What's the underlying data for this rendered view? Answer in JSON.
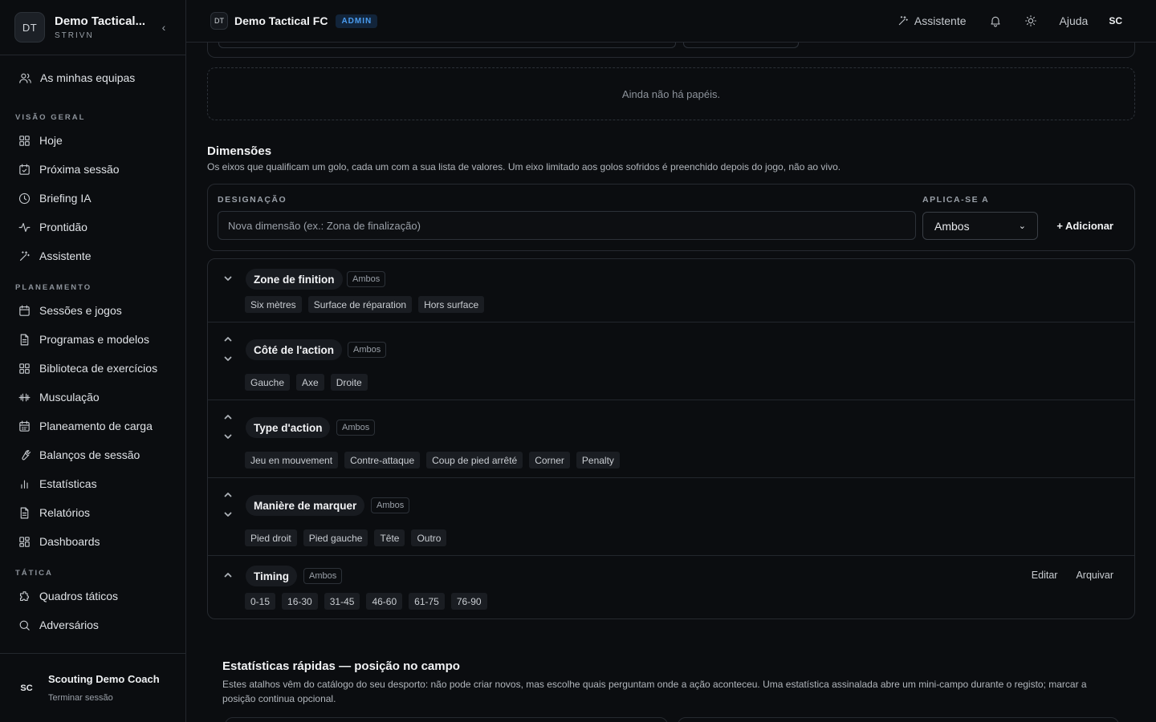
{
  "sidebar": {
    "team_initials": "DT",
    "team_name": "Demo Tactical...",
    "team_sub": "STRIVN",
    "my_teams": "As minhas equipas",
    "sections": [
      {
        "title": "VISÃO GERAL",
        "items": [
          "Hoje",
          "Próxima sessão",
          "Briefing IA",
          "Prontidão",
          "Assistente"
        ]
      },
      {
        "title": "PLANEAMENTO",
        "items": [
          "Sessões e jogos",
          "Programas e modelos",
          "Biblioteca de exercícios",
          "Musculação",
          "Planeamento de carga",
          "Balanços de sessão",
          "Estatísticas",
          "Relatórios",
          "Dashboards"
        ]
      },
      {
        "title": "TÁTICA",
        "items": [
          "Quadros táticos",
          "Adversários"
        ]
      }
    ],
    "user_initials": "SC",
    "user_name": "Scouting Demo Coach",
    "logout": "Terminar sessão"
  },
  "topbar": {
    "team_initials": "DT",
    "team_name": "Demo Tactical FC",
    "badge": "ADMIN",
    "assistant": "Assistente",
    "help": "Ajuda",
    "user_initials": "SC"
  },
  "roles": {
    "empty": "Ainda não há papéis."
  },
  "dimensions": {
    "title": "Dimensões",
    "description": "Os eixos que qualificam um golo, cada um com a sua lista de valores. Um eixo limitado aos golos sofridos é preenchido depois do jogo, não ao vivo.",
    "form": {
      "name_label": "DESIGNAÇÃO",
      "name_placeholder": "Nova dimensão (ex.: Zona de finalização)",
      "apply_label": "APLICA-SE A",
      "apply_value": "Ambos",
      "add_button": "+ Adicionar"
    },
    "rows": [
      {
        "name": "Zone de finition",
        "scope": "Ambos",
        "values": [
          "Six mètres",
          "Surface de réparation",
          "Hors surface"
        ]
      },
      {
        "name": "Côté de l'action",
        "scope": "Ambos",
        "values": [
          "Gauche",
          "Axe",
          "Droite"
        ]
      },
      {
        "name": "Type d'action",
        "scope": "Ambos",
        "values": [
          "Jeu en mouvement",
          "Contre-attaque",
          "Coup de pied arrêté",
          "Corner",
          "Penalty"
        ]
      },
      {
        "name": "Manière de marquer",
        "scope": "Ambos",
        "values": [
          "Pied droit",
          "Pied gauche",
          "Tête",
          "Outro"
        ]
      },
      {
        "name": "Timing",
        "scope": "Ambos",
        "values": [
          "0-15",
          "16-30",
          "31-45",
          "46-60",
          "61-75",
          "76-90"
        ],
        "edit": "Editar",
        "archive": "Arquivar"
      }
    ]
  },
  "quick_stats": {
    "title": "Estatísticas rápidas — posição no campo",
    "description": "Estes atalhos vêm do catálogo do seu desporto: não pode criar novos, mas escolhe quais perguntam onde a ação aconteceu. Uma estatística assinalada abre um mini-campo durante o registo; marcar a posição continua opcional."
  }
}
